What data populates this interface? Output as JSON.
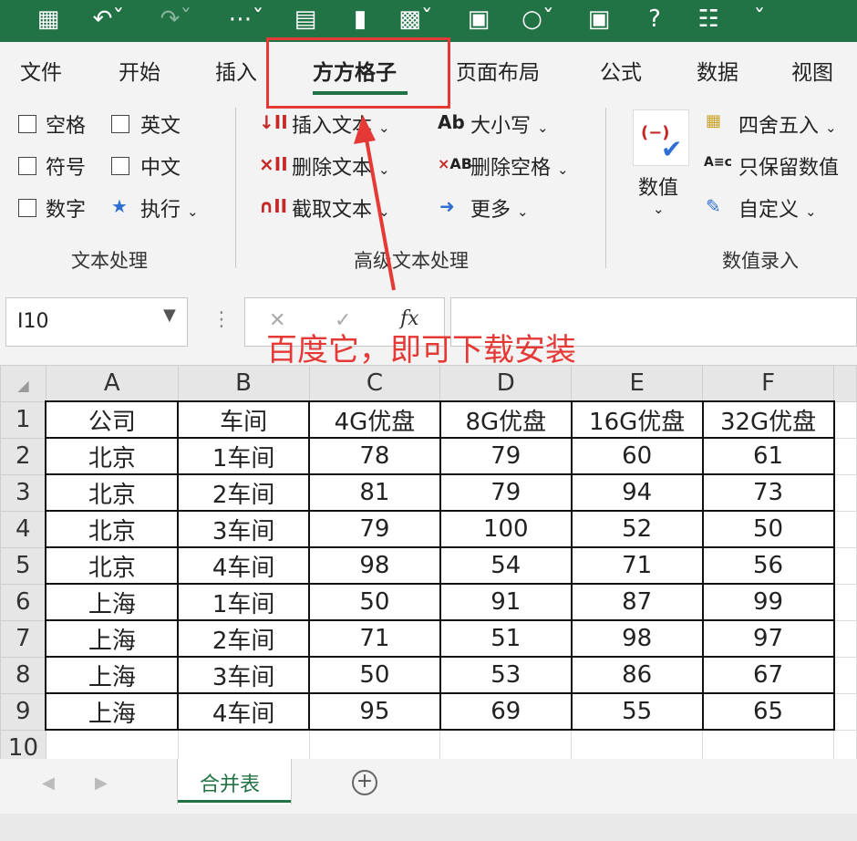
{
  "colors": {
    "brand": "#217346",
    "annotation": "#e53935"
  },
  "qat_icons": [
    "save-icon",
    "undo-icon",
    "redo-icon",
    "borders-icon",
    "form-icon",
    "chart-icon",
    "table-icon",
    "camera-icon",
    "shapes-icon",
    "textbox-icon",
    "help-icon",
    "print-icon",
    "customize-icon"
  ],
  "menu": {
    "tabs": [
      "文件",
      "开始",
      "插入",
      "方方格子",
      "页面布局",
      "公式",
      "数据",
      "视图"
    ]
  },
  "ribbon": {
    "text_group": {
      "checks": [
        "空格",
        "英文",
        "符号",
        "中文",
        "数字"
      ],
      "execute": "执行",
      "label": "文本处理"
    },
    "advanced_group": {
      "insert_text": "插入文本",
      "delete_text": "删除文本",
      "extract_text": "截取文本",
      "case": "大小写",
      "delete_space": "删除空格",
      "more": "更多",
      "case_icon": "Ab",
      "delete_space_icon": "AB",
      "label": "高级文本处理"
    },
    "number_group": {
      "big_button": "数值",
      "round": "四舍五入",
      "keep_values": "只保留数值",
      "custom": "自定义",
      "label": "数值录入"
    }
  },
  "formula_bar": {
    "name_box": "I10",
    "fx": "fx",
    "cancel": "✕",
    "confirm": "✓"
  },
  "annotation": "百度它，即可下载安装",
  "sheet": {
    "columns": [
      "A",
      "B",
      "C",
      "D",
      "E",
      "F"
    ],
    "rows": [
      [
        "公司",
        "车间",
        "4G优盘",
        "8G优盘",
        "16G优盘",
        "32G优盘"
      ],
      [
        "北京",
        "1车间",
        "78",
        "79",
        "60",
        "61"
      ],
      [
        "北京",
        "2车间",
        "81",
        "79",
        "94",
        "73"
      ],
      [
        "北京",
        "3车间",
        "79",
        "100",
        "52",
        "50"
      ],
      [
        "北京",
        "4车间",
        "98",
        "54",
        "71",
        "56"
      ],
      [
        "上海",
        "1车间",
        "50",
        "91",
        "87",
        "99"
      ],
      [
        "上海",
        "2车间",
        "71",
        "51",
        "98",
        "97"
      ],
      [
        "上海",
        "3车间",
        "50",
        "53",
        "86",
        "67"
      ],
      [
        "上海",
        "4车间",
        "95",
        "69",
        "55",
        "65"
      ]
    ],
    "row_numbers": [
      "1",
      "2",
      "3",
      "4",
      "5",
      "6",
      "7",
      "8",
      "9",
      "10"
    ]
  },
  "sheet_tabs": {
    "active": "合并表",
    "add": "+"
  }
}
